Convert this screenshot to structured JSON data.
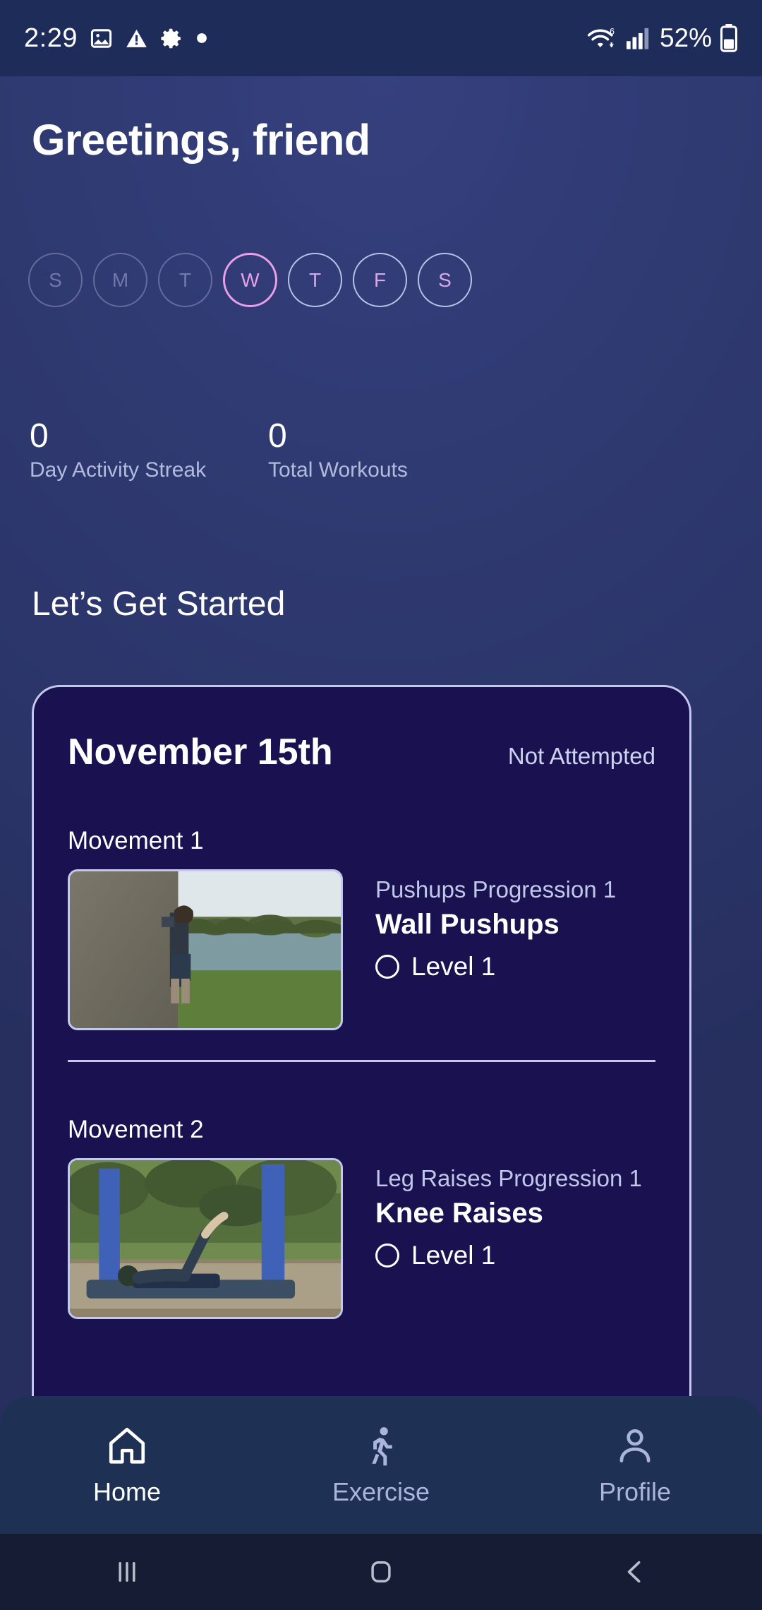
{
  "status_bar": {
    "time": "2:29",
    "battery_text": "52%",
    "icons": [
      "image-icon",
      "warning-icon",
      "gear-icon",
      "dot-icon",
      "wifi-icon",
      "signal-icon",
      "battery-icon"
    ],
    "wifi_label": "6"
  },
  "header": {
    "greeting": "Greetings, friend"
  },
  "week": {
    "days": [
      {
        "letter": "S",
        "state": "past"
      },
      {
        "letter": "M",
        "state": "past"
      },
      {
        "letter": "T",
        "state": "past"
      },
      {
        "letter": "W",
        "state": "today"
      },
      {
        "letter": "T",
        "state": "future"
      },
      {
        "letter": "F",
        "state": "future"
      },
      {
        "letter": "S",
        "state": "future"
      }
    ]
  },
  "stats": [
    {
      "value": "0",
      "label": "Day Activity Streak"
    },
    {
      "value": "0",
      "label": "Total Workouts"
    }
  ],
  "section": {
    "title": "Let’s Get Started"
  },
  "workout_card": {
    "date": "November 15th",
    "status": "Not Attempted",
    "movements": [
      {
        "label": "Movement 1",
        "progression": "Pushups Progression 1",
        "name": "Wall Pushups",
        "level": "Level 1",
        "thumbnail": "wall-pushups-video-thumbnail"
      },
      {
        "label": "Movement 2",
        "progression": "Leg Raises Progression 1",
        "name": "Knee Raises",
        "level": "Level 1",
        "thumbnail": "knee-raises-video-thumbnail"
      }
    ]
  },
  "bottom_nav": {
    "items": [
      {
        "label": "Home",
        "icon": "home-icon",
        "active": true
      },
      {
        "label": "Exercise",
        "icon": "running-person-icon",
        "active": false
      },
      {
        "label": "Profile",
        "icon": "person-icon",
        "active": false
      }
    ]
  },
  "system_nav": {
    "items": [
      "recents-icon",
      "home-square-icon",
      "back-chevron-icon"
    ]
  },
  "colors": {
    "accent_cyan": "#2ff0f0",
    "today_pink": "#e8a0e8",
    "card_bg": "#1a1150",
    "page_bg": "#2f3a72"
  }
}
